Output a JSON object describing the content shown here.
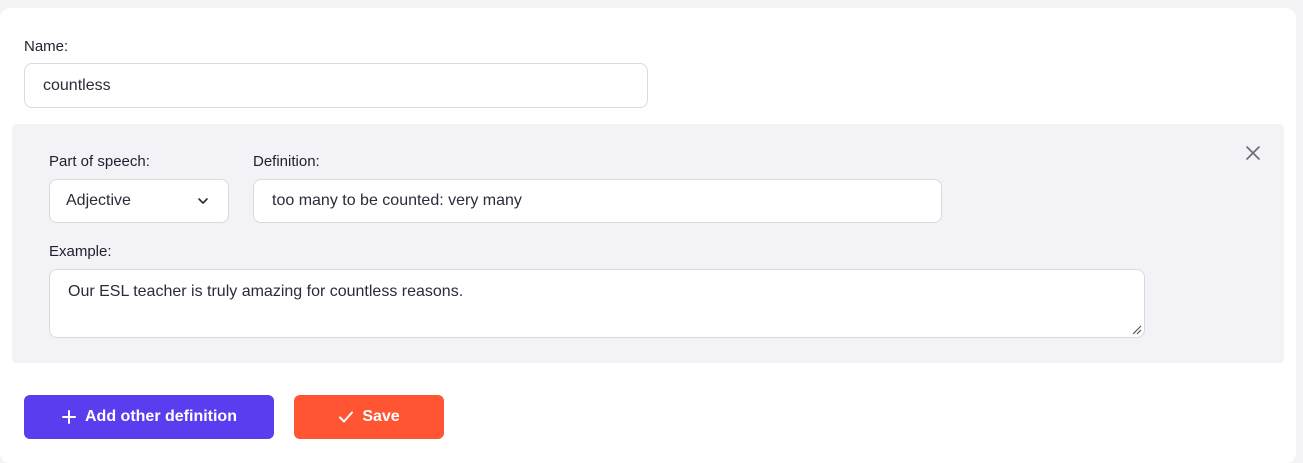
{
  "name_field": {
    "label": "Name:",
    "value": "countless"
  },
  "definition": {
    "part_of_speech_label": "Part of speech:",
    "part_of_speech_value": "Adjective",
    "definition_label": "Definition:",
    "definition_value": "too many to be counted: very many",
    "example_label": "Example:",
    "example_value": "Our ESL teacher is truly amazing for countless reasons.",
    "close_icon": "close-icon"
  },
  "actions": {
    "add_label": "Add other definition",
    "add_icon": "plus-icon",
    "save_label": "Save",
    "save_icon": "check-icon"
  },
  "colors": {
    "primary": "#5b3df0",
    "accent": "#ff5533",
    "panel": "#f2f2f7"
  }
}
